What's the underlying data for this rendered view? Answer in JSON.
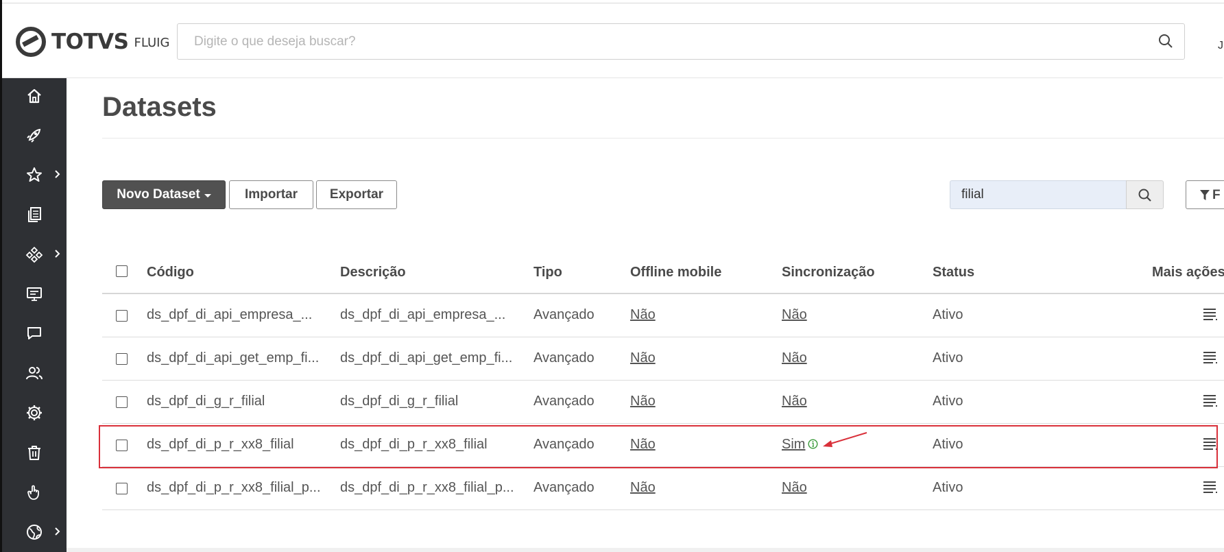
{
  "header": {
    "logo_brand": "TOTVS",
    "logo_product": "FLUIG",
    "search_placeholder": "Digite o que deseja buscar?",
    "user_glyph": "J"
  },
  "sidebar": {
    "items": [
      {
        "icon": "home-icon",
        "has_submenu": false
      },
      {
        "icon": "rocket-icon",
        "has_submenu": false
      },
      {
        "icon": "star-icon",
        "has_submenu": true
      },
      {
        "icon": "documents-icon",
        "has_submenu": false
      },
      {
        "icon": "workflow-icon",
        "has_submenu": true
      },
      {
        "icon": "monitor-icon",
        "has_submenu": false
      },
      {
        "icon": "chat-icon",
        "has_submenu": false
      },
      {
        "icon": "users-icon",
        "has_submenu": false
      },
      {
        "icon": "gear-icon",
        "has_submenu": false
      },
      {
        "icon": "trash-icon",
        "has_submenu": false
      },
      {
        "icon": "touch-icon",
        "has_submenu": false
      },
      {
        "icon": "globe-icon",
        "has_submenu": true
      }
    ]
  },
  "page": {
    "title": "Datasets"
  },
  "toolbar": {
    "new_label": "Novo Dataset",
    "import_label": "Importar",
    "export_label": "Exportar",
    "filter_value": "filial",
    "filters_label": "F"
  },
  "table": {
    "columns": [
      "Código",
      "Descrição",
      "Tipo",
      "Offline mobile",
      "Sincronização",
      "Status",
      "Mais ações"
    ],
    "rows": [
      {
        "code": "ds_dpf_di_api_empresa_...",
        "description": "ds_dpf_di_api_empresa_...",
        "type": "Avançado",
        "offline": "Não",
        "sync": "Não",
        "status": "Ativo"
      },
      {
        "code": "ds_dpf_di_api_get_emp_fi...",
        "description": "ds_dpf_di_api_get_emp_fi...",
        "type": "Avançado",
        "offline": "Não",
        "sync": "Não",
        "status": "Ativo"
      },
      {
        "code": "ds_dpf_di_g_r_filial",
        "description": "ds_dpf_di_g_r_filial",
        "type": "Avançado",
        "offline": "Não",
        "sync": "Não",
        "status": "Ativo"
      },
      {
        "code": "ds_dpf_di_p_r_xx8_filial",
        "description": "ds_dpf_di_p_r_xx8_filial",
        "type": "Avançado",
        "offline": "Não",
        "sync": "Sim",
        "status": "Ativo"
      },
      {
        "code": "ds_dpf_di_p_r_xx8_filial_p...",
        "description": "ds_dpf_di_p_r_xx8_filial_p...",
        "type": "Avançado",
        "offline": "Não",
        "sync": "Não",
        "status": "Ativo"
      }
    ]
  },
  "colors": {
    "sidebar_bg": "#2e3034",
    "highlight": "#d9303a",
    "info_green": "#3a9a3a",
    "primary_button": "#515151"
  }
}
